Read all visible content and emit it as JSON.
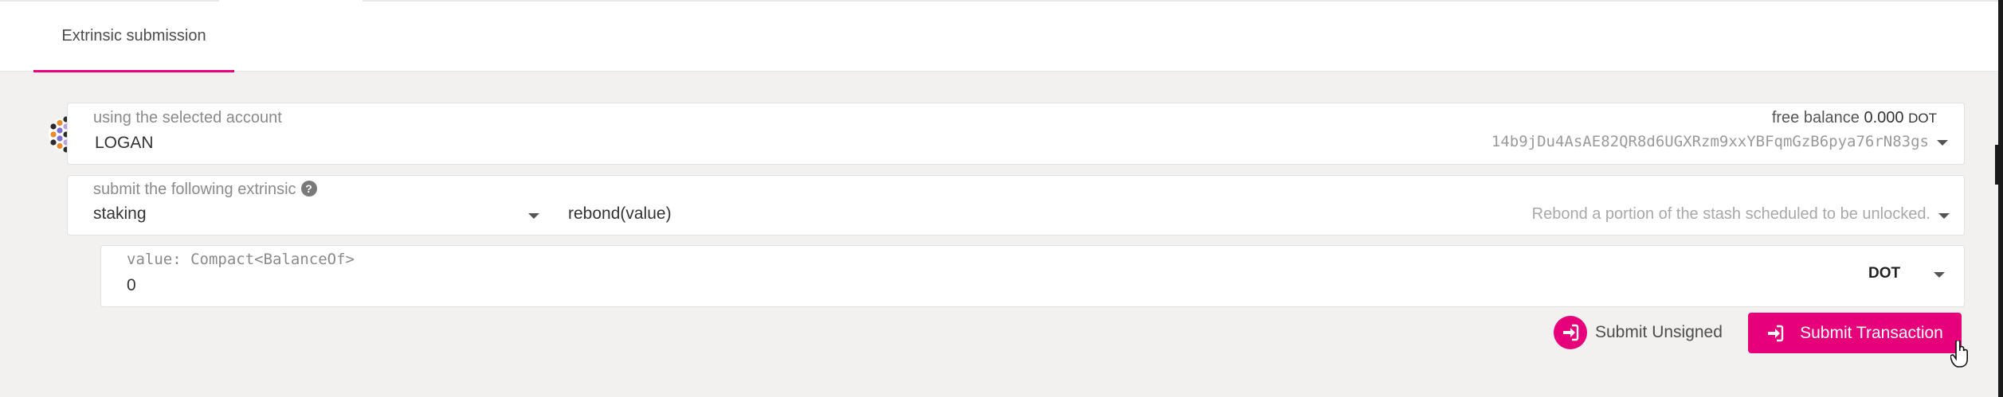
{
  "tabs": [
    {
      "label": "Extrinsic submission",
      "active": true
    }
  ],
  "account": {
    "label": "using the selected account",
    "name": "LOGAN",
    "balance_label": "free balance",
    "balance_value": "0.000",
    "balance_unit": "DOT",
    "address": "14b9jDu4AsAE82QR8d6UGXRzm9xxYBFqmGzB6pya76rN83gs"
  },
  "extrinsic": {
    "label": "submit the following extrinsic",
    "help_icon": "?",
    "module": "staking",
    "method": "rebond(value)",
    "description": "Rebond a portion of the stash scheduled to be unlocked."
  },
  "param": {
    "label": "value: Compact<BalanceOf>",
    "value": "0",
    "unit": "DOT"
  },
  "actions": {
    "unsigned_label": "Submit Unsigned",
    "submit_label": "Submit Transaction"
  },
  "colors": {
    "accent": "#e6007a",
    "background": "#f2f1f0",
    "panel": "#ffffff"
  },
  "icons": {
    "unsigned": "sign-in-icon",
    "submit": "sign-in-icon",
    "avatar": "identicon"
  }
}
